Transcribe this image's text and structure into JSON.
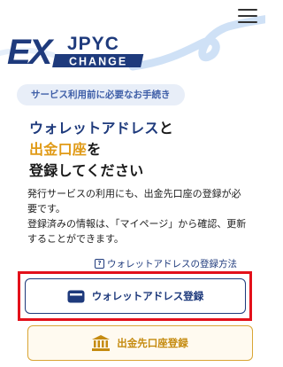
{
  "header": {
    "logo_icon": "exjpyc-exchange-logo",
    "logo_text": "EX JPYC CHANGE",
    "menu_icon": "hamburger-menu-icon"
  },
  "intro": {
    "badge": "サービス利用前に必要なお手続き",
    "heading_part1": "ウォレットアドレス",
    "heading_part2": "と",
    "heading_part3": "出金口座",
    "heading_part4": "を",
    "heading_part5": "登録してください",
    "description_line1": "発行サービスの利用にも、出金先口座の登録が必要です。",
    "description_line2": "登録済みの情報は、「マイページ」から確認、更新することができます。"
  },
  "links": {
    "wallet_howto": "ウォレットアドレスの登録方法",
    "wallet_howto_icon": "question-icon"
  },
  "actions": {
    "wallet_register_label": "ウォレットアドレス登録",
    "wallet_register_icon": "wallet-icon",
    "bank_register_label": "出金先口座登録",
    "bank_register_icon": "bank-icon"
  },
  "colors": {
    "primary": "#1e3a7c",
    "accent": "#e09a16",
    "highlight": "#e3101a",
    "badge_bg": "#e8eef8"
  }
}
